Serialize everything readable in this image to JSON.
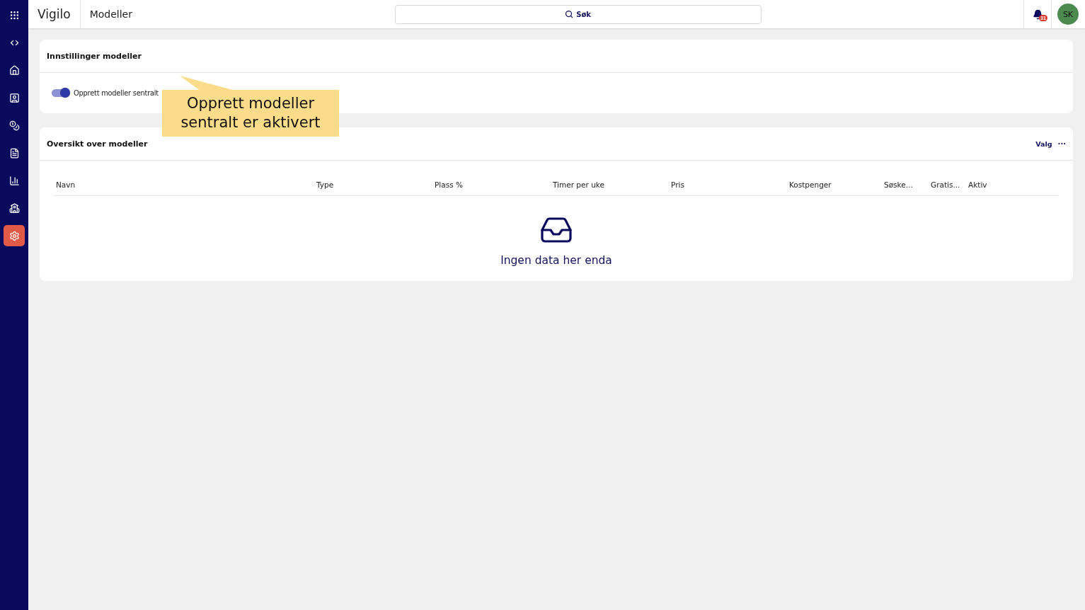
{
  "app": {
    "brand": "Vigilo",
    "page_title": "Modeller"
  },
  "search": {
    "label": "Søk"
  },
  "notifications": {
    "count": "31"
  },
  "user": {
    "initials": "SK"
  },
  "sidebar": {
    "items": [
      {
        "kind": "code",
        "selected": false
      },
      {
        "kind": "home",
        "selected": false
      },
      {
        "kind": "person",
        "selected": false
      },
      {
        "kind": "coins",
        "selected": false
      },
      {
        "kind": "document",
        "selected": false
      },
      {
        "kind": "chart",
        "selected": false
      },
      {
        "kind": "school",
        "selected": false
      },
      {
        "kind": "settings",
        "selected": true
      }
    ]
  },
  "settings_card": {
    "title": "Innstillinger modeller",
    "toggle": {
      "label": "Opprett modeller sentralt",
      "on": true
    }
  },
  "callout": {
    "text": "Opprett modeller sentralt er aktivert"
  },
  "overview_card": {
    "title": "Oversikt over modeller",
    "options_label": "Valg",
    "more": "···",
    "columns": [
      "Navn",
      "Type",
      "Plass %",
      "Timer per uke",
      "Pris",
      "Kostpenger",
      "Søske...",
      "Gratis...",
      "Aktiv"
    ],
    "empty_text": "Ingen data her enda"
  }
}
